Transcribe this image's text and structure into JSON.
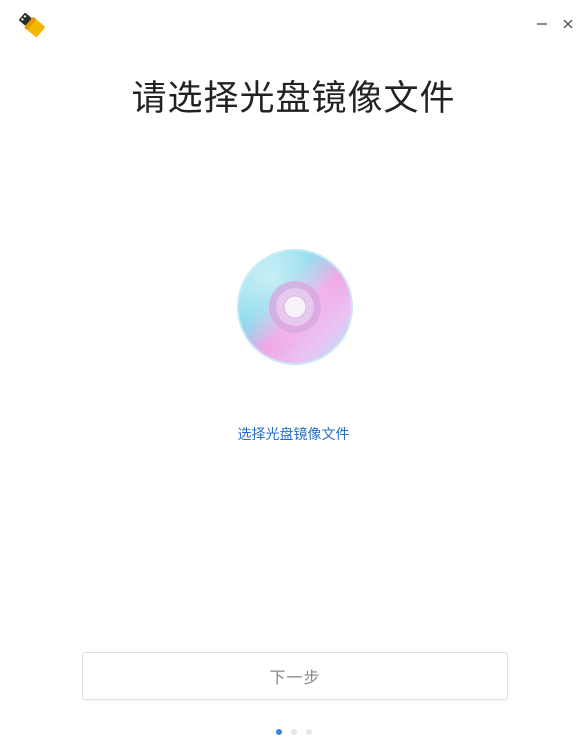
{
  "app": {
    "icon": "usb-drive-icon",
    "accent_color": "#f5b400"
  },
  "window_controls": {
    "minimize_icon": "minimize-icon",
    "close_icon": "close-icon"
  },
  "main": {
    "title": "请选择光盘镜像文件",
    "disc_icon": "optical-disc-icon",
    "select_link": "选择光盘镜像文件",
    "link_color": "#2a6fc8"
  },
  "footer": {
    "next_button_label": "下一步",
    "next_button_enabled": false,
    "pager": {
      "total": 3,
      "current": 1
    },
    "pager_active_color": "#3a86d8"
  }
}
